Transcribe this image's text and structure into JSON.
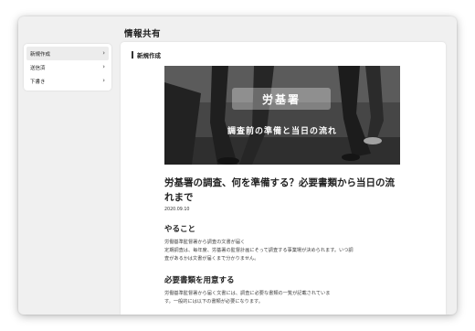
{
  "header": {
    "title": "情報共有"
  },
  "sidebar": {
    "items": [
      {
        "label": "新規作成",
        "icon": "chevron-right-icon"
      },
      {
        "label": "送信済",
        "icon": "chevron-right-icon"
      },
      {
        "label": "下書き",
        "icon": "chevron-right-icon"
      }
    ]
  },
  "main": {
    "section_title": "新規作成",
    "article": {
      "hero_title": "労基署",
      "hero_subtitle": "調査前の準備と当日の流れ",
      "title": "労基署の調査、何を準備する？必要書類から当日の流れまで",
      "date": "2020.09.10",
      "sections": [
        {
          "heading": "やること",
          "lines": [
            "労働基準監督署から調査の文書が届く",
            "定期調査は、毎年度、労基署の監督計画にそって調査する事業場が決められます。いつ調",
            "査があるかは文書が届くまで分かりません。"
          ]
        },
        {
          "heading": "必要書類を用意する",
          "lines": [
            "労働基準監督署から届く文書には、調査に必要な書類の一覧が記載されていま",
            "す。一般的には以下の書類が必要になります。"
          ]
        }
      ]
    }
  }
}
